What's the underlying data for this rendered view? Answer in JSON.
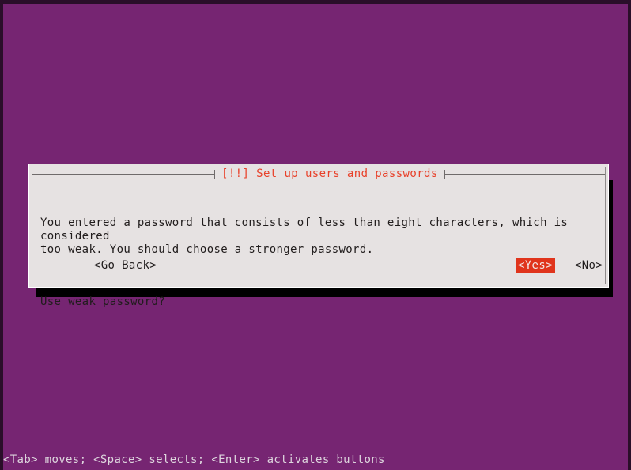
{
  "screen": {
    "background_color": "#762572",
    "border_color": "#2a0e29"
  },
  "dialog": {
    "title": "[!!] Set up users and passwords",
    "title_color": "#e8412a",
    "background_color": "#e6e2e2",
    "paragraphs": [
      "You entered a password that consists of less than eight characters, which is considered\ntoo weak. You should choose a stronger password.",
      "Use weak password?"
    ],
    "buttons": [
      {
        "label": "<Go Back>",
        "selected": false
      },
      {
        "label": "<Yes>",
        "selected": true,
        "highlight_color": "#e0341c"
      },
      {
        "label": "<No>",
        "selected": false
      }
    ]
  },
  "footer": {
    "hint": "<Tab> moves; <Space> selects; <Enter> activates buttons"
  }
}
